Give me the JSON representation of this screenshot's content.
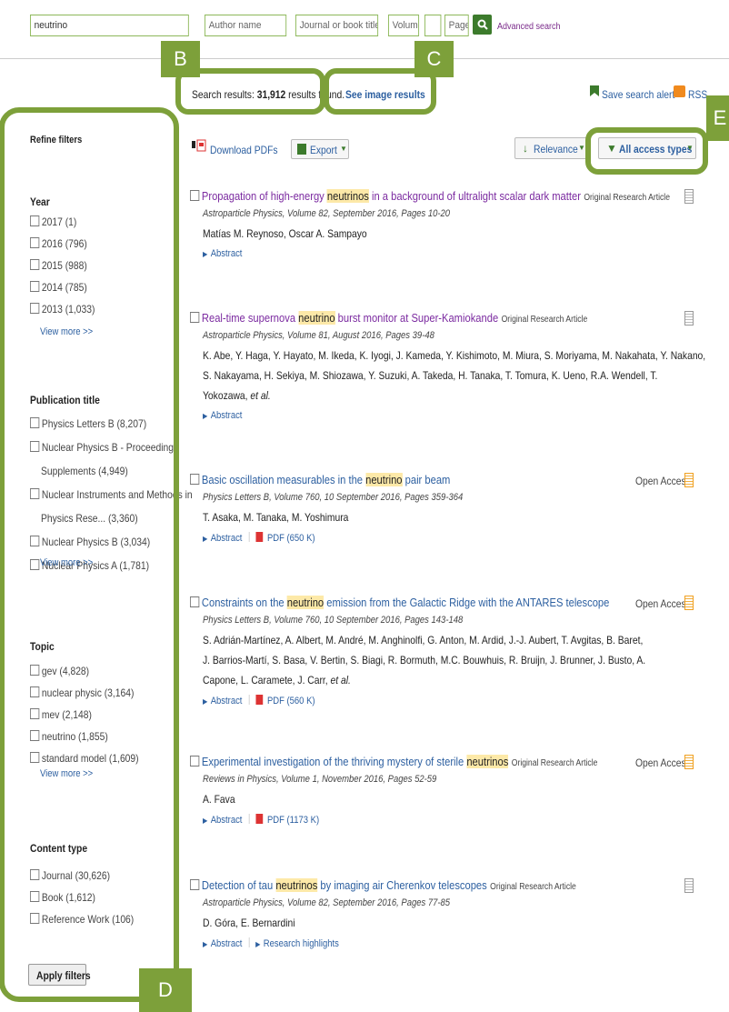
{
  "search": {
    "query": "neutrino",
    "author_placeholder": "Author name",
    "journal_placeholder": "Journal or book title",
    "volume_placeholder": "Volume",
    "issue_placeholder": "",
    "page_placeholder": "Page",
    "go_icon": "search-icon",
    "advanced_label": "Advanced search"
  },
  "results_bar": {
    "count_prefix": "Search results:",
    "count": "31,912",
    "count_suffix": "results found.",
    "image_results": "See image results",
    "save_alert": "Save search alert",
    "rss": "RSS"
  },
  "toolbar": {
    "download_pdfs": "Download PDFs",
    "export": "Export",
    "relevance": "Relevance",
    "access_types": "All access types"
  },
  "callouts": {
    "b": "B",
    "c": "C",
    "d": "D",
    "e": "E"
  },
  "sidebar": {
    "title": "Refine filters",
    "year_heading": "Year",
    "years": [
      "2017 (1)",
      "2016 (796)",
      "2015 (988)",
      "2014 (785)",
      "2013 (1,033)"
    ],
    "year_more": "View more >>",
    "pub_heading": "Publication title",
    "pubs": [
      "Physics Letters B (8,207)",
      "Nuclear Physics B - Proceedings",
      "Supplements (4,949)",
      "Nuclear Instruments and Methods in",
      "Physics Rese... (3,360)",
      "Nuclear Physics B (3,034)",
      "Nuclear Physics A (1,781)"
    ],
    "pub_more": "View more >>",
    "topic_heading": "Topic",
    "topics": [
      "gev (4,828)",
      "nuclear physic (3,164)",
      "mev (2,148)",
      "neutrino (1,855)",
      "standard model (1,609)"
    ],
    "topic_more": "View more >>",
    "content_heading": "Content type",
    "content": [
      "Journal (30,626)",
      "Book (1,612)",
      "Reference Work (106)"
    ],
    "apply": "Apply filters"
  },
  "results": [
    {
      "t1": "Propagation of high-energy ",
      "t_hl": "neutrinos",
      "t2": " in a background of ultralight scalar dark matter",
      "type": "Original Research Article",
      "meta": "Astroparticle Physics, Volume 82, September 2016, Pages 10-20",
      "authors": [
        "Matías M. Reynoso, Oscar A. Sampayo"
      ],
      "abstract": "Abstract"
    },
    {
      "t1": "Real-time supernova ",
      "t_hl": "neutrino",
      "t2": " burst monitor at Super-Kamiokande",
      "type": "Original Research Article",
      "meta": "Astroparticle Physics, Volume 81, August 2016, Pages 39-48",
      "authors": [
        "K. Abe, Y. Haga, Y. Hayato, M. Ikeda, K. Iyogi, J. Kameda, Y. Kishimoto, M. Miura, S. Moriyama, M. Nakahata, Y. Nakano,",
        "S. Nakayama, H. Sekiya, M. Shiozawa, Y. Suzuki, A. Takeda, H. Tanaka, T. Tomura, K. Ueno, R.A. Wendell, T.",
        "Yokozawa, "
      ],
      "etal": "et al.",
      "abstract": "Abstract"
    },
    {
      "t1": "Basic oscillation measurables in the ",
      "t_hl": "neutrino",
      "t2": " pair beam",
      "oa": "Open Access",
      "meta": "Physics Letters B, Volume 760, 10 September 2016, Pages 359-364",
      "authors": [
        "T. Asaka, M. Tanaka, M. Yoshimura"
      ],
      "abstract": "Abstract",
      "pdf": "PDF (650 K)"
    },
    {
      "t1": "Constraints on the ",
      "t_hl": "neutrino",
      "t2": " emission from the Galactic Ridge with the ANTARES telescope",
      "oa": "Open Access",
      "meta": "Physics Letters B, Volume 760, 10 September 2016, Pages 143-148",
      "authors": [
        "S. Adrián-Martínez, A. Albert, M. André, M. Anghinolfi, G. Anton, M. Ardid, J.-J. Aubert, T. Avgitas, B. Baret,",
        "J. Barrios-Martí, S. Basa, V. Bertin, S. Biagi, R. Bormuth, M.C. Bouwhuis, R. Bruijn, J. Brunner, J. Busto, A.",
        "Capone, L. Caramete, J. Carr, "
      ],
      "etal": "et al.",
      "abstract": "Abstract",
      "pdf": "PDF (560 K)"
    },
    {
      "t1": "Experimental investigation of the thriving mystery of sterile ",
      "t_hl": "neutrinos",
      "t2": "",
      "type": "Original Research Article",
      "oa": "Open Access",
      "meta": "Reviews in Physics, Volume 1, November 2016, Pages 52-59",
      "authors": [
        "A. Fava"
      ],
      "abstract": "Abstract",
      "pdf": "PDF (1173 K)"
    },
    {
      "t1": "Detection of tau ",
      "t_hl": "neutrinos",
      "t2": " by imaging air Cherenkov telescopes",
      "type": "Original Research Article",
      "meta": "Astroparticle Physics, Volume 82, September 2016, Pages 77-85",
      "authors": [
        "D. Góra, E. Bernardini"
      ],
      "abstract": "Abstract",
      "highlights": "Research highlights"
    }
  ]
}
